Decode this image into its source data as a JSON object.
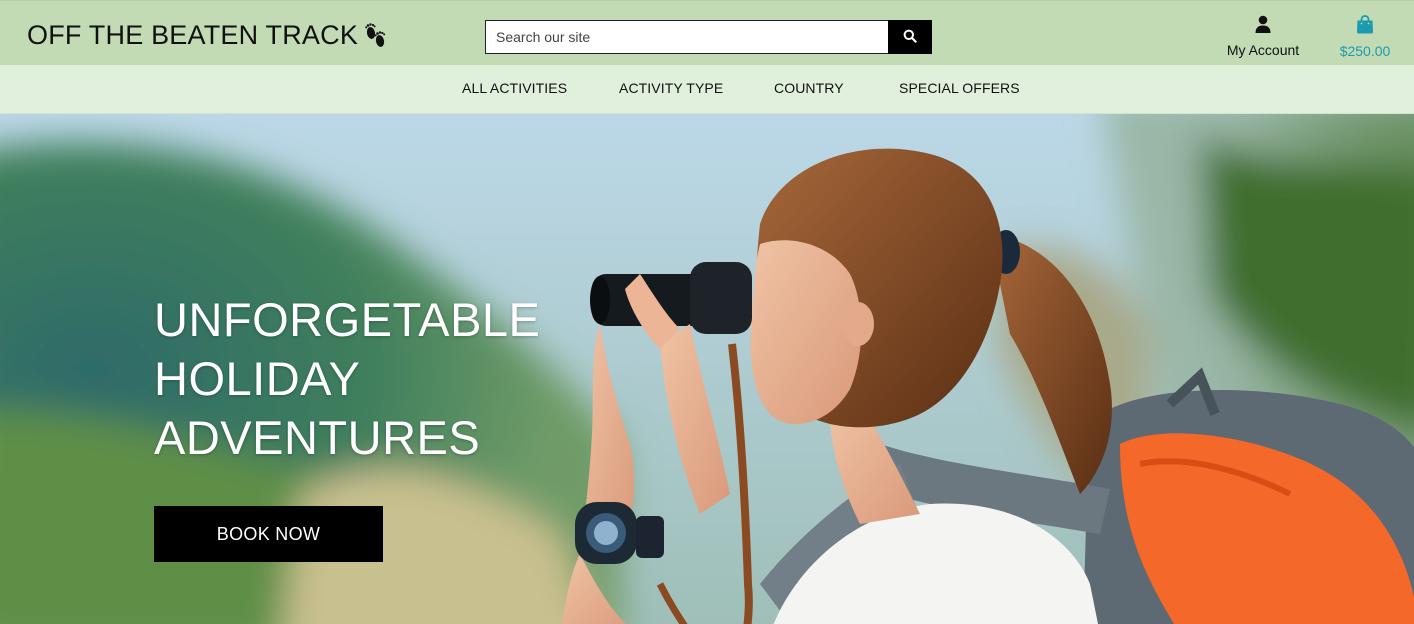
{
  "brand": {
    "name": "OFF THE BEATEN TRACK",
    "icon": "footprints-icon"
  },
  "search": {
    "placeholder": "Search our site",
    "value": "",
    "button_icon": "search-icon"
  },
  "account": {
    "label": "My Account",
    "icon": "user-icon"
  },
  "bag": {
    "total": "$250.00",
    "icon": "shopping-bag-icon",
    "color": "#1a9bb0"
  },
  "nav": {
    "items": [
      {
        "label": "ALL ACTIVITIES"
      },
      {
        "label": "ACTIVITY TYPE"
      },
      {
        "label": "COUNTRY"
      },
      {
        "label": "SPECIAL OFFERS"
      }
    ]
  },
  "hero": {
    "heading_lines": [
      "UNFORGETABLE",
      "HOLIDAY",
      "ADVENTURES"
    ],
    "cta_label": "BOOK NOW"
  },
  "colors": {
    "header_bg": "#c2dbb4",
    "nav_bg": "#e1efdd",
    "button_bg": "#000000",
    "accent": "#1a9bb0"
  }
}
